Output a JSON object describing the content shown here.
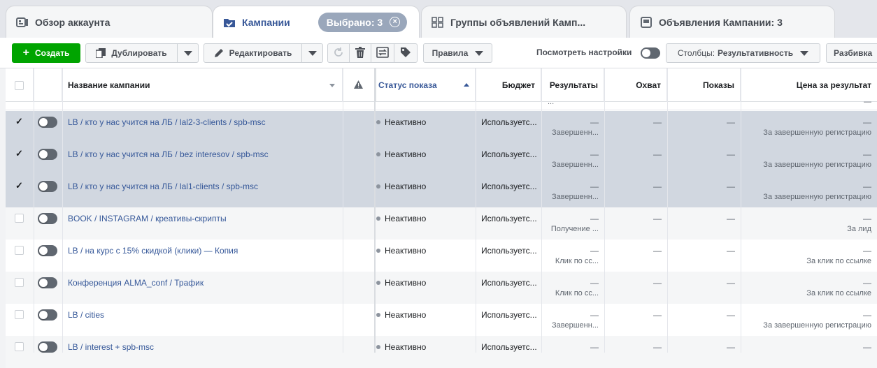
{
  "tabs": [
    {
      "label": "Обзор аккаунта",
      "icon": "account-overview-icon"
    },
    {
      "label": "Кампании",
      "icon": "folder-check-icon",
      "badge": "Выбрано: 3"
    },
    {
      "label": "Группы объявлений Камп...",
      "icon": "grid-icon"
    },
    {
      "label": "Объявления Кампании: 3",
      "icon": "ad-preview-icon"
    }
  ],
  "toolbar": {
    "create": "Создать",
    "duplicate": "Дублировать",
    "edit": "Редактировать",
    "rules": "Правила",
    "view_settings": "Посмотреть настройки",
    "columns_prefix": "Столбцы:",
    "columns_value": "Результативность",
    "breakdown": "Разбивка"
  },
  "columns": {
    "name": "Название кампании",
    "status": "Статус показа",
    "budget": "Бюджет",
    "results": "Результаты",
    "reach": "Охват",
    "impressions": "Показы",
    "cost_per_result": "Цена за результат"
  },
  "colors": {
    "accent": "#385898",
    "create_green": "#00a400",
    "selected_row": "#d1d7e0"
  },
  "partial_top": {
    "results_fragment": "...",
    "cpr_fragment": "—"
  },
  "rows": [
    {
      "checked": "✓",
      "name": "LB / кто у нас учится на ЛБ / lal2-3-clients / spb-msc",
      "status": "Неактивно",
      "budget": "Используетс...",
      "results": "—",
      "results_sub": "Завершенн...",
      "reach": "—",
      "impressions": "—",
      "cpr": "—",
      "cpr_sub": "За завершенную регистрацию"
    },
    {
      "checked": "✓",
      "name": "LB / кто у нас учится на ЛБ / bez interesov / spb-msc",
      "status": "Неактивно",
      "budget": "Используетс...",
      "results": "—",
      "results_sub": "Завершенн...",
      "reach": "—",
      "impressions": "—",
      "cpr": "—",
      "cpr_sub": "За завершенную регистрацию"
    },
    {
      "checked": "✓",
      "name": "LB / кто у нас учится на ЛБ / lal1-clients / spb-msc",
      "status": "Неактивно",
      "budget": "Используетс...",
      "results": "—",
      "results_sub": "Завершенн...",
      "reach": "—",
      "impressions": "—",
      "cpr": "—",
      "cpr_sub": "За завершенную регистрацию"
    },
    {
      "checked": "",
      "name": "BOOK / INSTAGRAM / креативы-скрипты",
      "status": "Неактивно",
      "budget": "Используетс...",
      "results": "—",
      "results_sub": "Получение ...",
      "reach": "—",
      "impressions": "—",
      "cpr": "—",
      "cpr_sub": "За лид"
    },
    {
      "checked": "",
      "name": "LB / на курс с 15% скидкой (клики) — Копия",
      "status": "Неактивно",
      "budget": "Используетс...",
      "results": "—",
      "results_sub": "Клик по сс...",
      "reach": "—",
      "impressions": "—",
      "cpr": "—",
      "cpr_sub": "За клик по ссылке"
    },
    {
      "checked": "",
      "name": "Конференция ALMA_conf / Трафик",
      "status": "Неактивно",
      "budget": "Используетс...",
      "results": "—",
      "results_sub": "Клик по сс...",
      "reach": "—",
      "impressions": "—",
      "cpr": "—",
      "cpr_sub": "За клик по ссылке"
    },
    {
      "checked": "",
      "name": "LB / cities",
      "status": "Неактивно",
      "budget": "Используетс...",
      "results": "—",
      "results_sub": "Завершенн...",
      "reach": "—",
      "impressions": "—",
      "cpr": "—",
      "cpr_sub": "За завершенную регистрацию"
    },
    {
      "checked": "",
      "name": "LB / interest + spb-msc",
      "status": "Неактивно",
      "budget": "Используетс...",
      "results": "—",
      "results_sub": "",
      "reach": "—",
      "impressions": "—",
      "cpr": "—",
      "cpr_sub": ""
    }
  ]
}
